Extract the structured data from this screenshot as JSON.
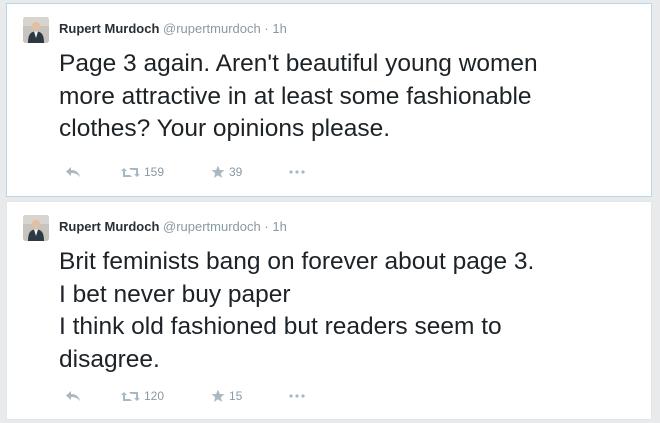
{
  "tweets": [
    {
      "author_name": "Rupert Murdoch",
      "author_handle": "@rupertmurdoch",
      "separator": "·",
      "time": "1h",
      "lines": [
        "Page 3 again.  Aren't beautiful young women",
        "more attractive in at least some fashionable",
        "clothes?   Your opinions please."
      ],
      "retweets": "159",
      "favorites": "39"
    },
    {
      "author_name": "Rupert Murdoch",
      "author_handle": "@rupertmurdoch",
      "separator": "·",
      "time": "1h",
      "lines": [
        "Brit feminists bang on forever about page 3.",
        "I bet never buy paper",
        "I think old fashioned but readers seem to",
        "disagree."
      ],
      "retweets": "120",
      "favorites": "15"
    }
  ],
  "icons": {
    "reply": "reply-icon",
    "retweet": "retweet-icon",
    "favorite": "star-icon",
    "more": "more-icon"
  },
  "colors": {
    "selected_border": "#b9d6ea",
    "icon": "#aab8c2",
    "meta_text": "#8899a6"
  }
}
